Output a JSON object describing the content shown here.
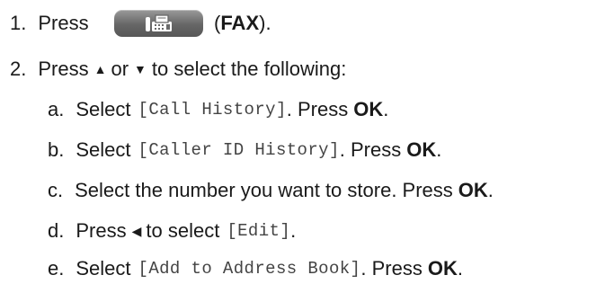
{
  "step1": {
    "num": "1.",
    "press": "Press",
    "fax_label": "FAX",
    "open": "(",
    "close": ")."
  },
  "step2": {
    "num": "2.",
    "press": "Press",
    "or": "or",
    "to_select": "to select the following:",
    "up_icon": "up-triangle-icon",
    "down_icon": "down-triangle-icon"
  },
  "substeps": {
    "a": {
      "letter": "a.",
      "select": "Select",
      "menu": "[Call History]",
      "press": ". Press",
      "key": "OK",
      "end": "."
    },
    "b": {
      "letter": "b.",
      "select": "Select",
      "menu": "[Caller ID History]",
      "press": ". Press",
      "key": "OK",
      "end": "."
    },
    "c": {
      "letter": "c.",
      "text": "Select the number you want to store. Press",
      "key": "OK",
      "end": "."
    },
    "d": {
      "letter": "d.",
      "press": "Press",
      "to_select": "to select",
      "menu": "[Edit]",
      "end": ".",
      "left_icon": "left-triangle-icon"
    },
    "e": {
      "letter": "e.",
      "select": "Select",
      "menu": "[Add to Address Book]",
      "press": ". Press",
      "key": "OK",
      "end": "."
    }
  },
  "icons": {
    "fax_button": "fax-machine-icon"
  }
}
